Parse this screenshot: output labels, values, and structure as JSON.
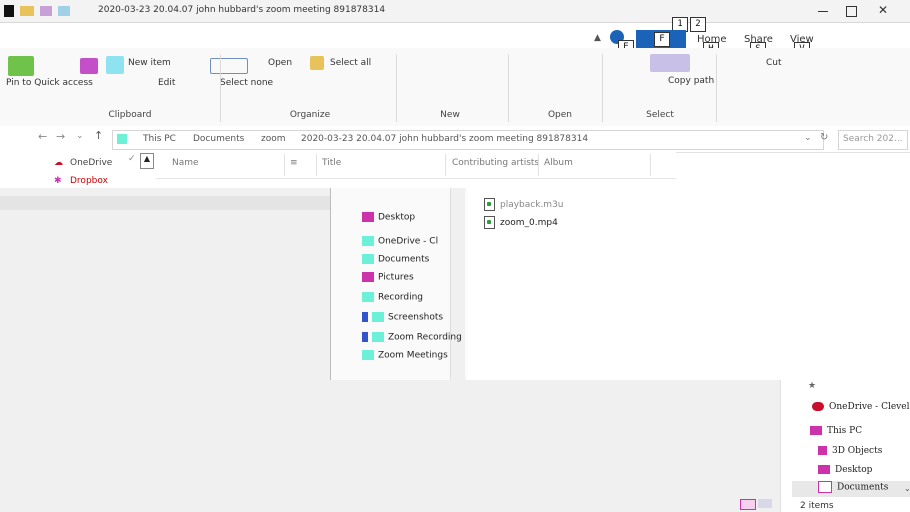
{
  "window": {
    "title": "2020-03-23 20.04.07 john hubbard's zoom meeting 891878314"
  },
  "ribbon": {
    "tabs": {
      "file": "F",
      "home": "Home",
      "share": "Share",
      "view": "View"
    },
    "key_tips": {
      "one": "1",
      "two": "2",
      "e": "E",
      "f": "F",
      "h": "H",
      "s": "S",
      "v": "V"
    },
    "groups": {
      "clipboard": "Clipboard",
      "organize": "Organize",
      "new": "New",
      "open": "Open",
      "select": "Select"
    },
    "items": {
      "pin_to_quick_access": "Pin to Quick access",
      "new_item": "New item",
      "open": "Open",
      "edit": "Edit",
      "select_all": "Select all",
      "select_none": "Select none",
      "copy_path": "Copy path",
      "cut": "Cut"
    }
  },
  "address_bar": {
    "path": [
      "This PC",
      "Documents",
      "zoom",
      "2020-03-23 20.04.07 john hubbard's zoom meeting 891878314"
    ],
    "search_placeholder": "Search 202..."
  },
  "nav_pane": {
    "onedrive": "OneDrive",
    "dropbox": "Dropbox"
  },
  "columns": {
    "name": "Name",
    "title": "Title",
    "contributing_artists": "Contributing artists",
    "album": "Album"
  },
  "dialog_sidebar": {
    "items": [
      "Desktop",
      "OneDrive - Cl",
      "Documents",
      "Pictures",
      "Recording",
      "Screenshots",
      "Zoom Recording",
      "Zoom Meetings"
    ]
  },
  "files": [
    "playback.m3u",
    "zoom_0.mp4"
  ],
  "lower_tree": {
    "items": [
      "OneDrive - Clevel",
      "This PC",
      "3D Objects",
      "Desktop",
      "Documents"
    ]
  },
  "status_bar": {
    "count": "2 items"
  },
  "colors": {
    "accent": "#1a63b8",
    "onedrive": "#c8102e",
    "highlight": "#cc33aa",
    "swatch": "#6cf0d8"
  }
}
